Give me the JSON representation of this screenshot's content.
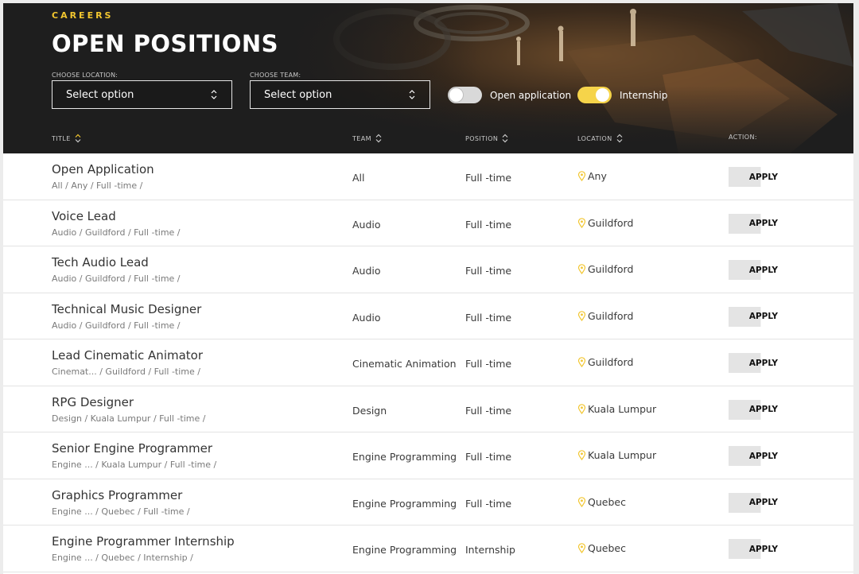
{
  "header": {
    "eyebrow": "CAREERS",
    "title": "OPEN POSITIONS",
    "location_label": "CHOOSE LOCATION:",
    "location_value": "Select option",
    "team_label": "CHOOSE TEAM:",
    "team_value": "Select option",
    "toggle_open_label": "Open application",
    "toggle_open_on": false,
    "toggle_intern_label": "Internship",
    "toggle_intern_on": true
  },
  "columns": {
    "title": "TITLE",
    "team": "TEAM",
    "position": "POSITION",
    "location": "LOCATION",
    "action": "ACTION:"
  },
  "colors": {
    "accent": "#f2c62f",
    "toggle_on": "#f6d44a",
    "header_bg": "#1e1e1e"
  },
  "jobs": [
    {
      "title": "Open Application",
      "meta": "All / Any / Full -time /",
      "team": "All",
      "position": "Full -time",
      "location": "Any",
      "action": "APPLY"
    },
    {
      "title": "Voice Lead",
      "meta": "Audio / Guildford / Full -time /",
      "team": "Audio",
      "position": "Full -time",
      "location": "Guildford",
      "action": "APPLY"
    },
    {
      "title": "Tech Audio Lead",
      "meta": "Audio / Guildford / Full -time /",
      "team": "Audio",
      "position": "Full -time",
      "location": "Guildford",
      "action": "APPLY"
    },
    {
      "title": "Technical Music Designer",
      "meta": "Audio / Guildford / Full -time /",
      "team": "Audio",
      "position": "Full -time",
      "location": "Guildford",
      "action": "APPLY"
    },
    {
      "title": "Lead Cinematic Animator",
      "meta": "Cinemat... / Guildford / Full -time /",
      "team": "Cinematic Animation",
      "position": "Full -time",
      "location": "Guildford",
      "action": "APPLY"
    },
    {
      "title": "RPG Designer",
      "meta": "Design / Kuala Lumpur / Full -time /",
      "team": "Design",
      "position": "Full -time",
      "location": "Kuala Lumpur",
      "action": "APPLY"
    },
    {
      "title": "Senior Engine Programmer",
      "meta": "Engine ... / Kuala Lumpur / Full -time /",
      "team": "Engine Programming",
      "position": "Full -time",
      "location": "Kuala Lumpur",
      "action": "APPLY"
    },
    {
      "title": "Graphics Programmer",
      "meta": "Engine ... / Quebec / Full -time /",
      "team": "Engine Programming",
      "position": "Full -time",
      "location": "Quebec",
      "action": "APPLY"
    },
    {
      "title": "Engine Programmer Internship",
      "meta": "Engine ... / Quebec / Internship /",
      "team": "Engine Programming",
      "position": "Internship",
      "location": "Quebec",
      "action": "APPLY"
    }
  ]
}
